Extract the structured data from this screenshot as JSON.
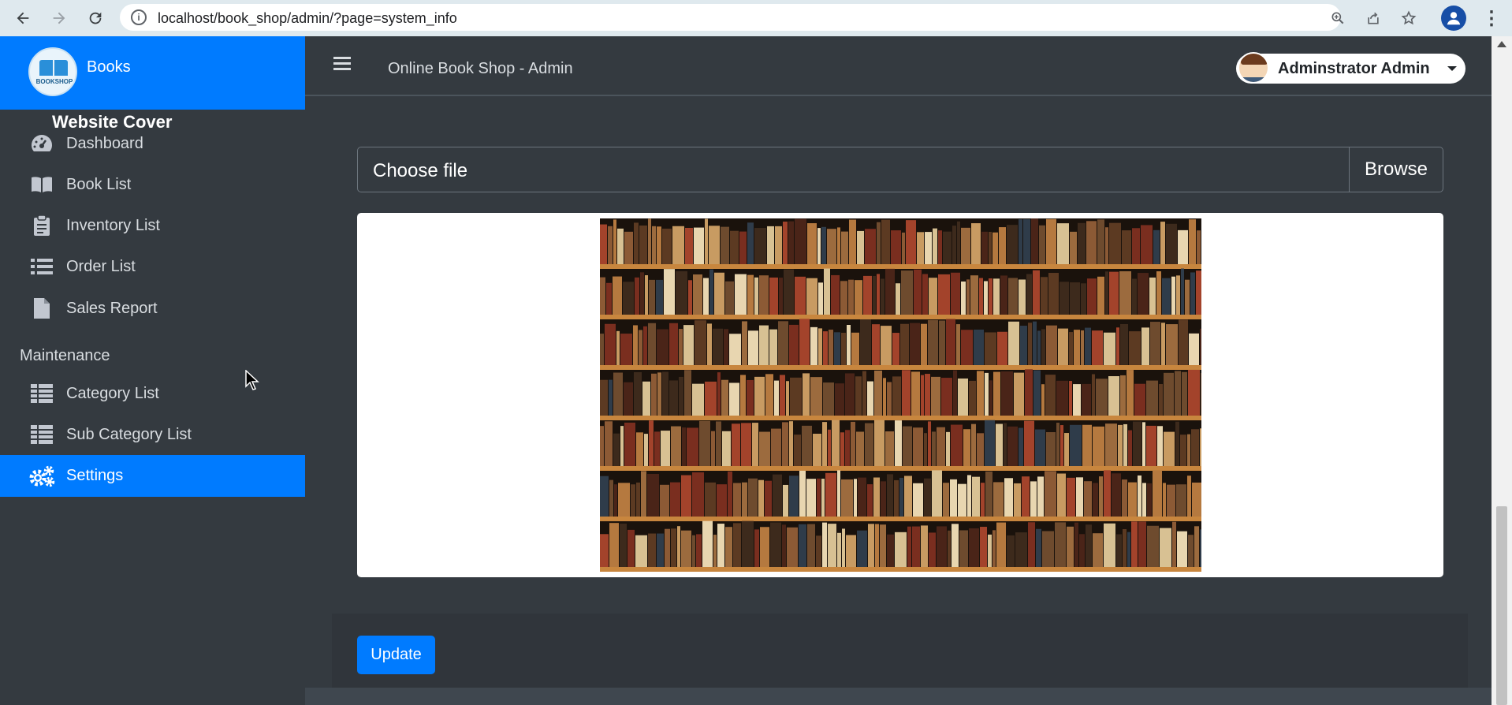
{
  "browser": {
    "url": "localhost/book_shop/admin/?page=system_info",
    "icons": [
      "back-arrow-icon",
      "forward-arrow-icon",
      "reload-icon",
      "info-icon",
      "zoom-icon",
      "share-icon",
      "star-icon",
      "profile-icon",
      "kebab-menu-icon"
    ]
  },
  "brand": {
    "name": "Books",
    "logo_text": "BOOKSHOP"
  },
  "sidebar": {
    "items": [
      {
        "label": "Dashboard",
        "icon": "dashboard-gauge-icon"
      },
      {
        "label": "Book List",
        "icon": "book-icon"
      },
      {
        "label": "Inventory List",
        "icon": "clipboard-icon"
      },
      {
        "label": "Order List",
        "icon": "list-icon"
      },
      {
        "label": "Sales Report",
        "icon": "file-icon"
      }
    ],
    "maintenance_header": "Maintenance",
    "maintenance_items": [
      {
        "label": "Category List",
        "icon": "table-icon"
      },
      {
        "label": "Sub Category List",
        "icon": "table-icon"
      },
      {
        "label": "Settings",
        "icon": "cogs-icon",
        "active": true
      }
    ]
  },
  "topnav": {
    "title": "Online Book Shop - Admin",
    "user": "Adminstrator Admin"
  },
  "form": {
    "cover_label": "Website Cover",
    "file_placeholder": "Choose file",
    "browse_label": "Browse",
    "update_label": "Update"
  },
  "colors": {
    "primary": "#007bff",
    "sidebar_bg": "#343a40",
    "content_bg": "#343a40"
  }
}
